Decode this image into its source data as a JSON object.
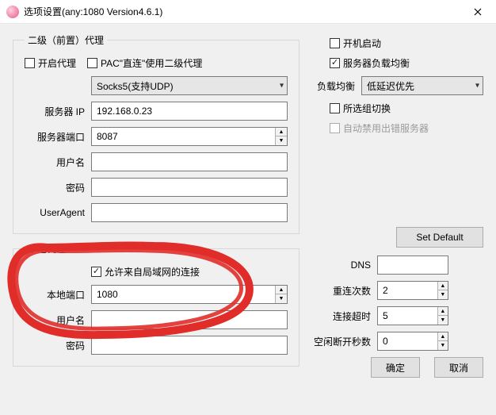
{
  "window": {
    "title": "选项设置(any:1080 Version4.6.1)",
    "close_tooltip": "Close"
  },
  "proxy2": {
    "legend": "二级（前置）代理",
    "enable_label": "开启代理",
    "enable_checked": false,
    "pac_label": "PAC\"直连\"使用二级代理",
    "pac_checked": false,
    "protocol_label": "",
    "protocol_value": "Socks5(支持UDP)",
    "server_ip_label": "服务器 IP",
    "server_ip_value": "192.168.0.23",
    "server_port_label": "服务器端口",
    "server_port_value": "8087",
    "user_label": "用户名",
    "user_value": "",
    "password_label": "密码",
    "password_value": "",
    "useragent_label": "UserAgent",
    "useragent_value": ""
  },
  "right_opts": {
    "autostart_label": "开机启动",
    "autostart_checked": false,
    "loadbalance_label": "服务器负载均衡",
    "loadbalance_checked": true,
    "loadbalance_mode_label": "负载均衡",
    "loadbalance_mode_value": "低延迟优先",
    "group_switch_label": "所选组切换",
    "group_switch_checked": false,
    "auto_disable_label": "自动禁用出错服务器",
    "auto_disable_checked": false,
    "auto_disable_enabled": false
  },
  "local": {
    "legend": "本地代理",
    "allow_lan_label": "允许来自局域网的连接",
    "allow_lan_checked": true,
    "port_label": "本地端口",
    "port_value": "1080",
    "user_label": "用户名",
    "user_value": "",
    "password_label": "密码",
    "password_value": ""
  },
  "right_form": {
    "set_default_label": "Set Default",
    "dns_label": "DNS",
    "dns_value": "",
    "reconnect_label": "重连次数",
    "reconnect_value": "2",
    "timeout_label": "连接超时",
    "timeout_value": "5",
    "idle_label": "空闲断开秒数",
    "idle_value": "0"
  },
  "footer": {
    "ok_label": "确定",
    "cancel_label": "取消"
  }
}
